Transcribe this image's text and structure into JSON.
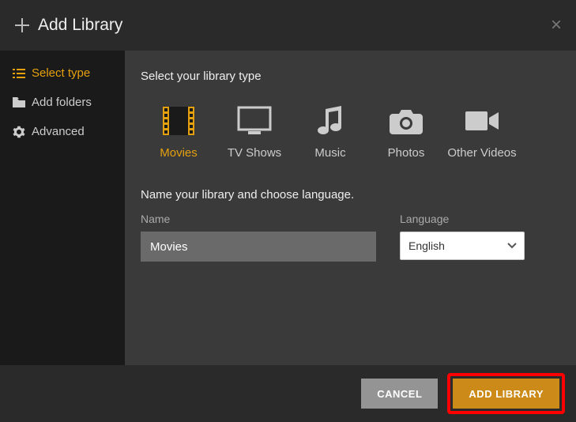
{
  "header": {
    "title": "Add Library"
  },
  "sidebar": {
    "items": [
      {
        "label": "Select type",
        "active": true
      },
      {
        "label": "Add folders",
        "active": false
      },
      {
        "label": "Advanced",
        "active": false
      }
    ]
  },
  "content": {
    "select_type_label": "Select your library type",
    "types": [
      {
        "label": "Movies",
        "selected": true
      },
      {
        "label": "TV Shows",
        "selected": false
      },
      {
        "label": "Music",
        "selected": false
      },
      {
        "label": "Photos",
        "selected": false
      },
      {
        "label": "Other Videos",
        "selected": false
      }
    ],
    "help_text": "Name your library and choose language.",
    "name_label": "Name",
    "name_value": "Movies",
    "language_label": "Language",
    "language_value": "English"
  },
  "footer": {
    "cancel": "CANCEL",
    "add_library": "ADD LIBRARY"
  },
  "colors": {
    "accent": "#e5a00d",
    "primary_btn": "#cc8b19",
    "highlight": "#ff0000"
  }
}
